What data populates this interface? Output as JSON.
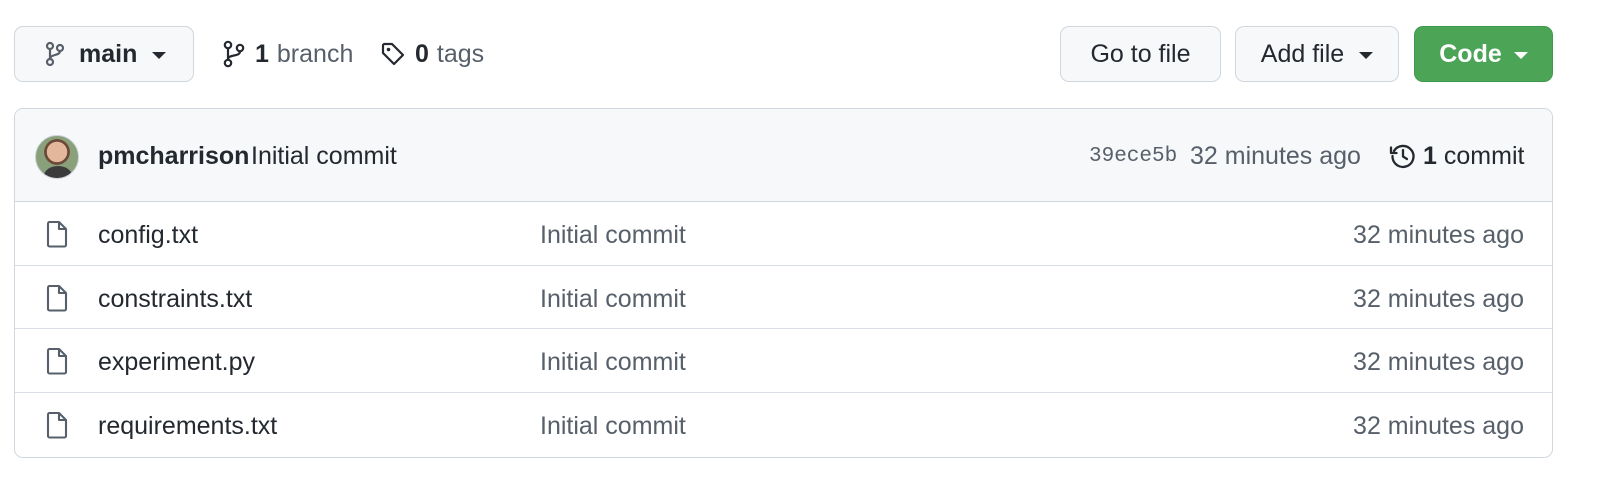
{
  "toolbar": {
    "branch_button_label": "main",
    "branch_count": "1",
    "branch_word": "branch",
    "tag_count": "0",
    "tag_word": "tags",
    "goto_file_label": "Go to file",
    "add_file_label": "Add file",
    "code_label": "Code",
    "code_button_color": "#4ca557"
  },
  "latest_commit": {
    "author": "pmcharrison",
    "message": "Initial commit",
    "sha": "39ece5b",
    "time": "32 minutes ago",
    "commit_count": "1",
    "commit_word": "commit"
  },
  "files": [
    {
      "name": "config.txt",
      "commit": "Initial commit",
      "age": "32 minutes ago",
      "icon": "file-icon"
    },
    {
      "name": "constraints.txt",
      "commit": "Initial commit",
      "age": "32 minutes ago",
      "icon": "file-icon"
    },
    {
      "name": "experiment.py",
      "commit": "Initial commit",
      "age": "32 minutes ago",
      "icon": "file-icon"
    },
    {
      "name": "requirements.txt",
      "commit": "Initial commit",
      "age": "32 minutes ago",
      "icon": "file-icon"
    }
  ]
}
